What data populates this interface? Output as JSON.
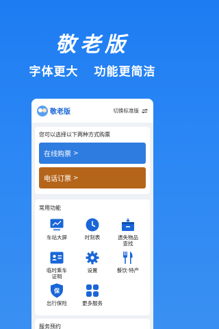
{
  "hero": {
    "title": "敬老版",
    "sub_left": "字体更大",
    "sub_right": "功能更简洁"
  },
  "header": {
    "brand": "敬老版",
    "switch_label": "切换标准版"
  },
  "tickets": {
    "prompt": "您可以选择以下两种方式购票",
    "online": "在线购票",
    "phone": "电话订票",
    "arrow": ">"
  },
  "functions": {
    "title": "常用功能",
    "items": [
      {
        "label": "车站大屏",
        "icon": "station-screen-icon"
      },
      {
        "label": "时刻表",
        "icon": "clock-icon"
      },
      {
        "label": "遗失物品\n查找",
        "icon": "lost-item-box-icon"
      },
      {
        "label": "临时乘车\n证明",
        "icon": "id-card-icon"
      },
      {
        "label": "设置",
        "icon": "gear-icon"
      },
      {
        "label": "餐饮·特产",
        "icon": "fork-knife-icon"
      },
      {
        "label": "出行保险",
        "icon": "insurance-shield-icon"
      },
      {
        "label": "更多服务",
        "icon": "grid-icon"
      }
    ]
  },
  "services": {
    "title": "服务预约"
  },
  "colors": {
    "background": "#1d7cf2",
    "online_button": "#2f7ce0",
    "phone_button": "#b5651a",
    "icon_blue": "#1a66d8"
  }
}
